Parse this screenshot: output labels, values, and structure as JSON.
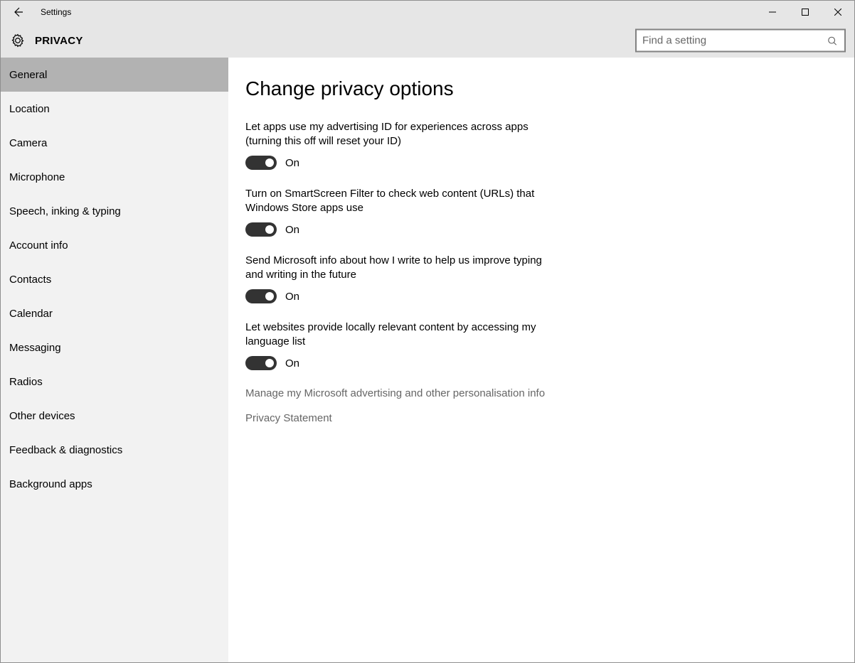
{
  "window": {
    "title": "Settings"
  },
  "header": {
    "page_title": "PRIVACY"
  },
  "search": {
    "placeholder": "Find a setting",
    "value": ""
  },
  "sidebar": {
    "items": [
      {
        "label": "General",
        "selected": true
      },
      {
        "label": "Location",
        "selected": false
      },
      {
        "label": "Camera",
        "selected": false
      },
      {
        "label": "Microphone",
        "selected": false
      },
      {
        "label": "Speech, inking & typing",
        "selected": false
      },
      {
        "label": "Account info",
        "selected": false
      },
      {
        "label": "Contacts",
        "selected": false
      },
      {
        "label": "Calendar",
        "selected": false
      },
      {
        "label": "Messaging",
        "selected": false
      },
      {
        "label": "Radios",
        "selected": false
      },
      {
        "label": "Other devices",
        "selected": false
      },
      {
        "label": "Feedback & diagnostics",
        "selected": false
      },
      {
        "label": "Background apps",
        "selected": false
      }
    ]
  },
  "content": {
    "heading": "Change privacy options",
    "options": [
      {
        "label": "Let apps use my advertising ID for experiences across apps (turning this off will reset your ID)",
        "state": "On"
      },
      {
        "label": "Turn on SmartScreen Filter to check web content (URLs) that Windows Store apps use",
        "state": "On"
      },
      {
        "label": "Send Microsoft info about how I write to help us improve typing and writing in the future",
        "state": "On"
      },
      {
        "label": "Let websites provide locally relevant content by accessing my language list",
        "state": "On"
      }
    ],
    "links": [
      {
        "label": "Manage my Microsoft advertising and other personalisation info"
      },
      {
        "label": "Privacy Statement"
      }
    ]
  }
}
